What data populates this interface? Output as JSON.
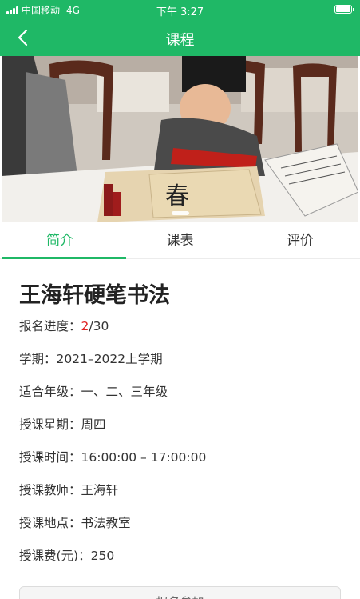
{
  "status_bar": {
    "carrier": "中国移动",
    "network": "4G",
    "time": "下午 3:27"
  },
  "nav": {
    "title": "课程",
    "back_icon": "chevron-left-icon"
  },
  "tabs": [
    {
      "label": "简介",
      "active": true
    },
    {
      "label": "课表",
      "active": false
    },
    {
      "label": "评价",
      "active": false
    }
  ],
  "course": {
    "title": "王海轩硬笔书法",
    "enroll_label": "报名进度：",
    "enroll_current": "2",
    "enroll_total": "/30",
    "rows": [
      "学期：2021–2022上学期",
      "适合年级：一、二、三年级",
      "授课星期：周四",
      "授课时间：16:00:00 – 17:00:00",
      "授课教师：王海轩",
      "授课地点：书法教室",
      "授课费(元)：250"
    ]
  },
  "bottom_button": {
    "label": "报名参加"
  },
  "colors": {
    "accent": "#1fb866",
    "highlight": "#e02020"
  }
}
